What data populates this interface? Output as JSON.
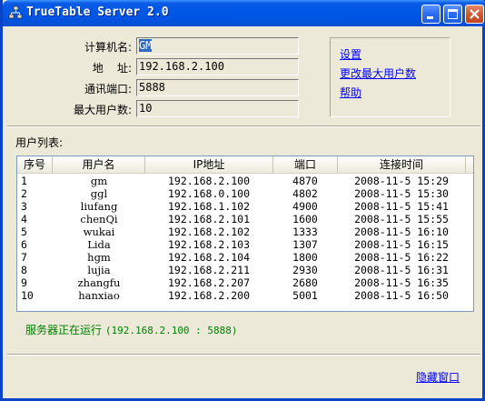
{
  "window": {
    "title": "TrueTable Server 2.0"
  },
  "info": {
    "computer_name_label": "计算机名:",
    "computer_name_value": "GM",
    "address_label": "地    址:",
    "address_value": "192.168.2.100",
    "port_label": "通讯端口:",
    "port_value": "5888",
    "max_users_label": "最大用户数:",
    "max_users_value": "10"
  },
  "links": {
    "settings": "设置",
    "change_max_users": "更改最大用户数",
    "help": "帮助"
  },
  "user_list": {
    "title": "用户列表:",
    "columns": [
      "序号",
      "用户名",
      "IP地址",
      "端口",
      "连接时间"
    ],
    "rows": [
      [
        "1",
        "gm",
        "192.168.2.100",
        "4870",
        "2008-11-5 15:29"
      ],
      [
        "2",
        "ggl",
        "192.168.0.100",
        "4802",
        "2008-11-5 15:30"
      ],
      [
        "3",
        "liufang",
        "192.168.1.102",
        "4900",
        "2008-11-5 15:41"
      ],
      [
        "4",
        "chenQi",
        "192.168.2.101",
        "1600",
        "2008-11-5 15:55"
      ],
      [
        "5",
        "wukai",
        "192.168.2.102",
        "1333",
        "2008-11-5 16:10"
      ],
      [
        "6",
        "Lida",
        "192.168.2.103",
        "1307",
        "2008-11-5 16:15"
      ],
      [
        "7",
        "hgm",
        "192.168.2.104",
        "1800",
        "2008-11-5 16:22"
      ],
      [
        "8",
        "lujia",
        "192.168.2.211",
        "2930",
        "2008-11-5 16:31"
      ],
      [
        "9",
        "zhangfu",
        "192.168.2.207",
        "2680",
        "2008-11-5 16:35"
      ],
      [
        "10",
        "hanxiao",
        "192.168.2.200",
        "5001",
        "2008-11-5 16:50"
      ]
    ]
  },
  "status": {
    "text": "服务器正在运行",
    "detail": "(192.168.2.100 : 5888)",
    "color": "#008000"
  },
  "footer": {
    "hide_window": "隐藏窗口"
  },
  "icons": {
    "app": "network-icon",
    "minimize": "minimize-icon",
    "maximize": "maximize-icon",
    "close": "close-icon"
  }
}
